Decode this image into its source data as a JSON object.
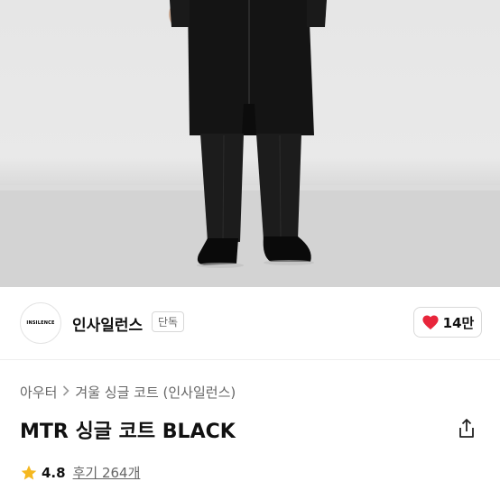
{
  "brand": {
    "logo_text": "INSILENCE",
    "name": "인사일런스",
    "badge": "단독"
  },
  "like": {
    "count": "14만",
    "icon": "heart-icon"
  },
  "breadcrumb": {
    "items": [
      "아우터",
      "겨울 싱글 코트 (인사일런스)"
    ],
    "separator_icon": "chevron-right-icon"
  },
  "product": {
    "title": "MTR 싱글 코트 BLACK"
  },
  "rating": {
    "score": "4.8",
    "reviews_label": "후기 264개",
    "icon": "star-icon"
  },
  "colors": {
    "heart": "#e8253b",
    "star": "#f5b820"
  }
}
